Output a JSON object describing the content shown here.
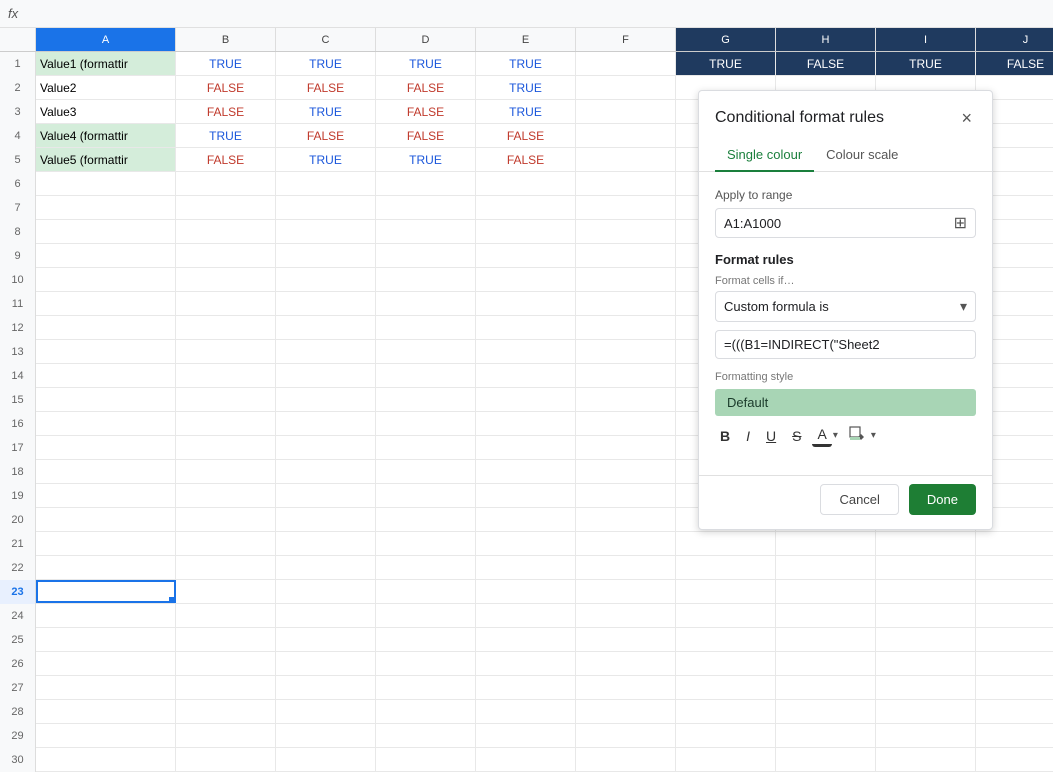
{
  "formulabar": {
    "label": "fx"
  },
  "columns": {
    "headers": [
      "",
      "A",
      "B",
      "C",
      "D",
      "E",
      "F",
      "G",
      "H",
      "I",
      "J"
    ]
  },
  "rows": [
    {
      "num": "1",
      "a": "Value1 (formattir",
      "b": "TRUE",
      "c": "TRUE",
      "d": "TRUE",
      "e": "TRUE",
      "g": "TRUE",
      "h": "FALSE",
      "i": "TRUE",
      "j": "FALSE",
      "a_green": true
    },
    {
      "num": "2",
      "a": "Value2",
      "b": "FALSE",
      "c": "FALSE",
      "d": "FALSE",
      "e": "TRUE",
      "g": "",
      "h": "",
      "i": "",
      "j": ""
    },
    {
      "num": "3",
      "a": "Value3",
      "b": "FALSE",
      "c": "TRUE",
      "d": "FALSE",
      "e": "TRUE",
      "g": "",
      "h": "",
      "i": "",
      "j": ""
    },
    {
      "num": "4",
      "a": "Value4 (formattir",
      "b": "TRUE",
      "c": "FALSE",
      "d": "FALSE",
      "e": "FALSE",
      "g": "",
      "h": "",
      "i": "",
      "j": "",
      "a_green": true
    },
    {
      "num": "5",
      "a": "Value5 (formattir",
      "b": "FALSE",
      "c": "TRUE",
      "d": "TRUE",
      "e": "FALSE",
      "g": "",
      "h": "",
      "i": "",
      "j": "",
      "a_green": true
    }
  ],
  "panel": {
    "title": "Conditional format rules",
    "close_label": "×",
    "tabs": [
      {
        "label": "Single colour",
        "active": true
      },
      {
        "label": "Colour scale",
        "active": false
      }
    ],
    "apply_to_range_label": "Apply to range",
    "range_value": "A1:A1000",
    "format_rules_label": "Format rules",
    "format_cells_if_label": "Format cells if…",
    "dropdown_value": "Custom formula is",
    "formula_value": "=(((B1=INDIRECT(\"Sheet2",
    "formatting_style_label": "Formatting style",
    "style_preview_text": "Default",
    "toolbar": {
      "bold": "B",
      "italic": "I",
      "underline": "U",
      "strikethrough": "S",
      "text_color": "A",
      "fill_color": "🎨"
    },
    "cancel_label": "Cancel",
    "done_label": "Done"
  },
  "active_cell": {
    "row": 23,
    "col": "A"
  }
}
